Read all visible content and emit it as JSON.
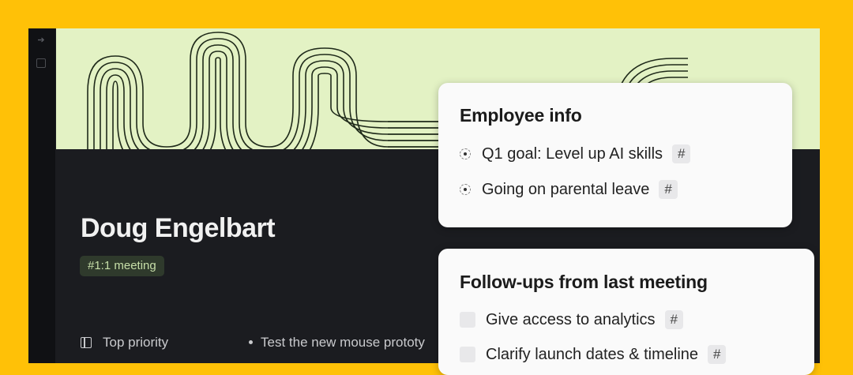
{
  "banner": {
    "accent_color": "#e3f2c4",
    "line_color": "#1f2a1a"
  },
  "page": {
    "title": "Doug Engelbart",
    "tag": "#1:1 meeting",
    "priority_label": "Top priority",
    "bullet_text": "Test the new mouse prototy"
  },
  "employee_card": {
    "title": "Employee info",
    "items": [
      {
        "text": "Q1 goal: Level up AI skills",
        "tag": "#"
      },
      {
        "text": "Going on parental leave",
        "tag": "#"
      }
    ]
  },
  "followups_card": {
    "title": "Follow-ups from last meeting",
    "items": [
      {
        "text": "Give access to analytics",
        "tag": "#"
      },
      {
        "text": "Clarify launch dates & timeline",
        "tag": "#"
      }
    ]
  },
  "colors": {
    "frame_border": "#FFC107",
    "app_background": "#1b1c20",
    "card_background": "#fafafa"
  }
}
